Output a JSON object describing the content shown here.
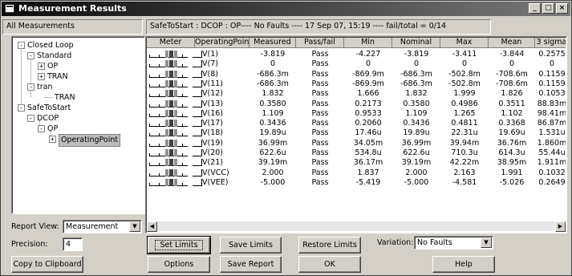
{
  "window": {
    "title": "Measurement Results"
  },
  "top": {
    "all_measurements": "All Measurements",
    "status": "SafeToStart : DCOP : OP---- No Faults ----   17 Sep 07, 15:19 ---- fail/total = 0/14"
  },
  "tree": [
    {
      "label": "Closed Loop",
      "sign": "-"
    },
    {
      "label": "Standard",
      "sign": "-"
    },
    {
      "label": "OP",
      "sign": "+"
    },
    {
      "label": "TRAN",
      "sign": "+"
    },
    {
      "label": "tran",
      "sign": "-"
    },
    {
      "label": "TRAN",
      "sign": ""
    },
    {
      "label": "SafeToStart",
      "sign": "-"
    },
    {
      "label": "DCOP",
      "sign": "-"
    },
    {
      "label": "OP",
      "sign": "-"
    },
    {
      "label": "OperatingPoint",
      "sign": "+"
    }
  ],
  "columns": [
    "Meter",
    "OperatingPoint",
    "Measured",
    "Pass/fail",
    "Min",
    "Nominal",
    "Max",
    "Mean",
    "3 sigma"
  ],
  "rows": [
    {
      "name": "V(1)",
      "measured": "-3.819",
      "passfail": "Pass",
      "min": "-4.227",
      "nominal": "-3.819",
      "max": "-3.411",
      "mean": "-3.844",
      "sigma": "0.2575"
    },
    {
      "name": "V(7)",
      "measured": "0",
      "passfail": "Pass",
      "min": "0",
      "nominal": "0",
      "max": "0",
      "mean": "0",
      "sigma": "0"
    },
    {
      "name": "V(8)",
      "measured": "-686.3m",
      "passfail": "Pass",
      "min": "-869.9m",
      "nominal": "-686.3m",
      "max": "-502.8m",
      "mean": "-708.6m",
      "sigma": "0.1159"
    },
    {
      "name": "V(11)",
      "measured": "-686.3m",
      "passfail": "Pass",
      "min": "-869.9m",
      "nominal": "-686.3m",
      "max": "-502.8m",
      "mean": "-708.6m",
      "sigma": "0.1159"
    },
    {
      "name": "V(12)",
      "measured": "1.832",
      "passfail": "Pass",
      "min": "1.666",
      "nominal": "1.832",
      "max": "1.999",
      "mean": "1.826",
      "sigma": "0.1053"
    },
    {
      "name": "V(13)",
      "measured": "0.3580",
      "passfail": "Pass",
      "min": "0.2173",
      "nominal": "0.3580",
      "max": "0.4986",
      "mean": "0.3511",
      "sigma": "88.83m"
    },
    {
      "name": "V(16)",
      "measured": "1.109",
      "passfail": "Pass",
      "min": "0.9533",
      "nominal": "1.109",
      "max": "1.265",
      "mean": "1.102",
      "sigma": "98.41m"
    },
    {
      "name": "V(17)",
      "measured": "0.3436",
      "passfail": "Pass",
      "min": "0.2060",
      "nominal": "0.3436",
      "max": "0.4811",
      "mean": "0.3368",
      "sigma": "86.87m"
    },
    {
      "name": "V(18)",
      "measured": "19.89u",
      "passfail": "Pass",
      "min": "17.46u",
      "nominal": "19.89u",
      "max": "22.31u",
      "mean": "19.69u",
      "sigma": "1.531u"
    },
    {
      "name": "V(19)",
      "measured": "36.99m",
      "passfail": "Pass",
      "min": "34.05m",
      "nominal": "36.99m",
      "max": "39.94m",
      "mean": "36.76m",
      "sigma": "1.860m"
    },
    {
      "name": "V(20)",
      "measured": "622.6u",
      "passfail": "Pass",
      "min": "534.8u",
      "nominal": "622.6u",
      "max": "710.3u",
      "mean": "614.3u",
      "sigma": "55.44u"
    },
    {
      "name": "V(21)",
      "measured": "39.19m",
      "passfail": "Pass",
      "min": "36.17m",
      "nominal": "39.19m",
      "max": "42.22m",
      "mean": "38.95m",
      "sigma": "1.911m"
    },
    {
      "name": "V(VCC)",
      "measured": "2.000",
      "passfail": "Pass",
      "min": "1.837",
      "nominal": "2.000",
      "max": "2.163",
      "mean": "1.991",
      "sigma": "0.1032"
    },
    {
      "name": "V(VEE)",
      "measured": "-5.000",
      "passfail": "Pass",
      "min": "-5.419",
      "nominal": "-5.000",
      "max": "-4.581",
      "mean": "-5.026",
      "sigma": "0.2649"
    }
  ],
  "controls": {
    "report_view_label": "Report View:",
    "report_view_value": "Measurement",
    "precision_label": "Precision:",
    "precision_value": "4",
    "variation_label": "Variation:",
    "variation_value": "No Faults"
  },
  "buttons": {
    "set_limits": "Set Limits",
    "save_limits": "Save Limits",
    "restore_limits": "Restore Limits",
    "copy_clipboard": "Copy to Clipboard",
    "options": "Options",
    "save_report": "Save Report",
    "ok": "OK",
    "help": "Help"
  },
  "icons": {
    "minimize": "minimize-icon",
    "maximize": "maximize-icon",
    "close": "close-icon",
    "dropdown": "chevron-down-icon",
    "scroll_left": "arrow-left-icon",
    "scroll_right": "arrow-right-icon"
  }
}
